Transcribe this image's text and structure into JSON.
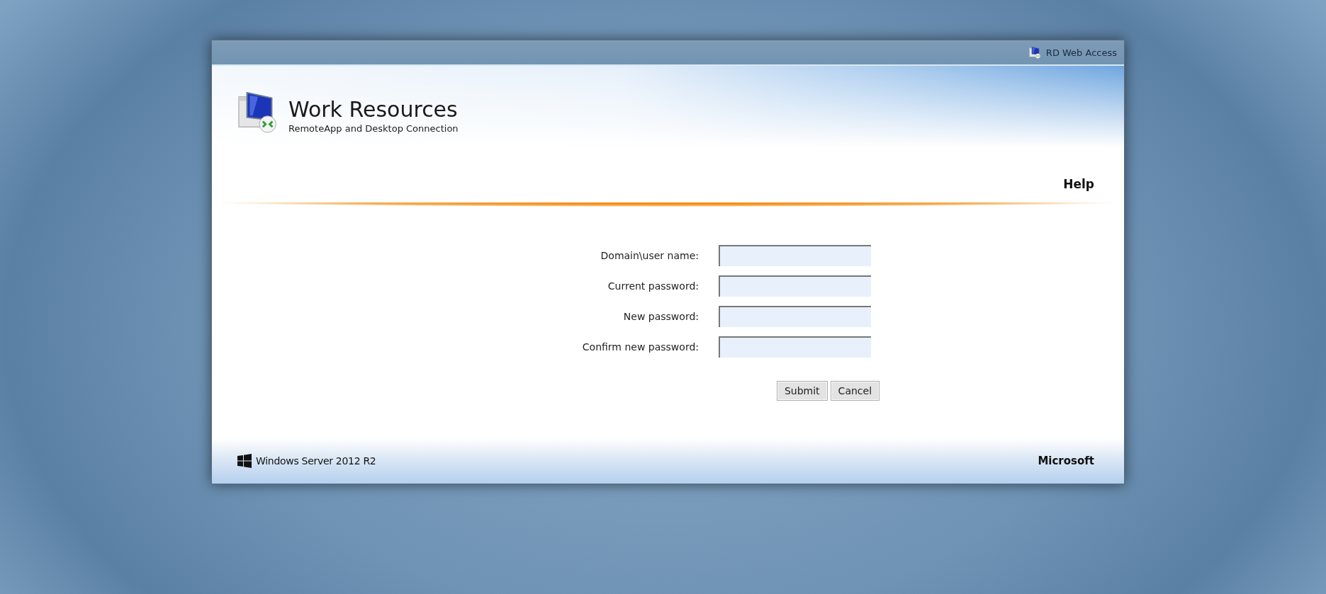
{
  "top_bar": {
    "link": "RD Web Access"
  },
  "header": {
    "title": "Work Resources",
    "subtitle": "RemoteApp and Desktop Connection",
    "help": "Help"
  },
  "form": {
    "fields": [
      {
        "label": "Domain\\user name:"
      },
      {
        "label": "Current password:"
      },
      {
        "label": "New password:"
      },
      {
        "label": "Confirm new password:"
      }
    ],
    "buttons": [
      "Submit",
      "Cancel"
    ]
  },
  "footer": {
    "product": "Windows Server 2012 R2",
    "company": "Microsoft"
  }
}
